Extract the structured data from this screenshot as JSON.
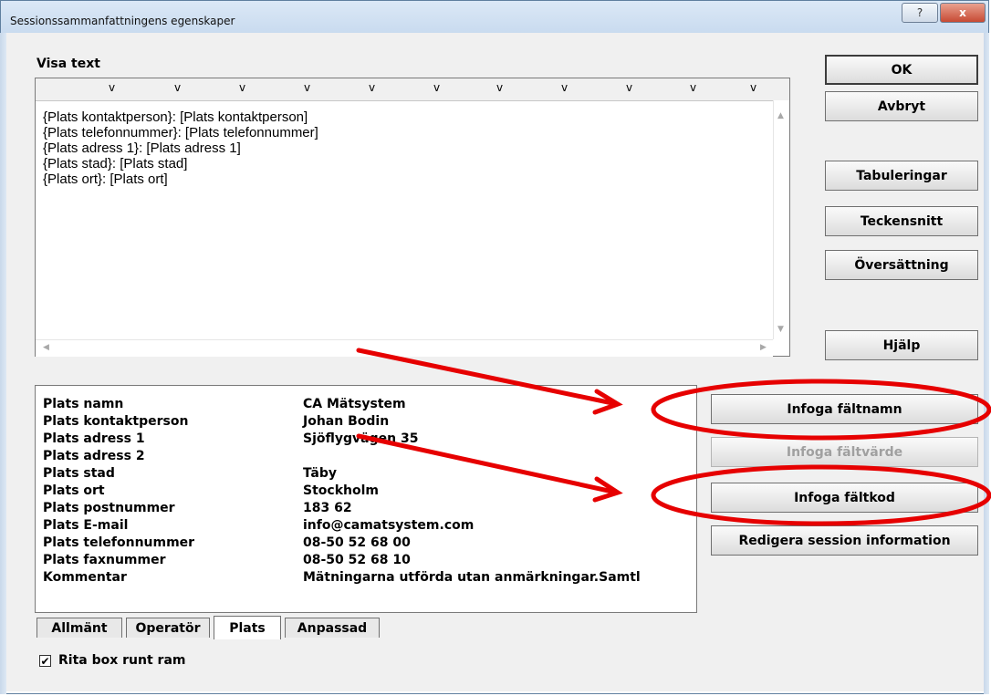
{
  "window": {
    "title": "Sessionssammanfattningens egenskaper",
    "help_glyph": "?",
    "close_glyph": "x"
  },
  "display_text": {
    "label": "Visa text",
    "ruler_marks": [
      "v",
      "v",
      "v",
      "v",
      "v",
      "v",
      "v",
      "v",
      "v",
      "v",
      "v"
    ],
    "lines": [
      "{Plats kontaktperson}: [Plats kontaktperson]",
      "{Plats telefonnummer}: [Plats telefonnummer]",
      "{Plats adress 1}: [Plats adress 1]",
      "{Plats stad}: [Plats stad]",
      "{Plats ort}: [Plats ort]"
    ],
    "scroll_up": "▲",
    "scroll_down": "▼",
    "scroll_left": "◀",
    "scroll_right": "▶"
  },
  "buttons": {
    "ok": "OK",
    "cancel": "Avbryt",
    "tabs_setup": "Tabuleringar",
    "font": "Teckensnitt",
    "translation": "Översättning",
    "help": "Hjälp",
    "insert_field_name": "Infoga fältnamn",
    "insert_field_value": "Infoga fältvärde",
    "insert_field_code": "Infoga fältkod",
    "edit_session_info": "Redigera session information"
  },
  "fields": [
    {
      "name": "Plats namn",
      "value": "CA Mätsystem"
    },
    {
      "name": "Plats kontaktperson",
      "value": "Johan Bodin"
    },
    {
      "name": "Plats adress 1",
      "value": "Sjöflygvägen 35"
    },
    {
      "name": "Plats adress 2",
      "value": ""
    },
    {
      "name": "Plats stad",
      "value": "Täby"
    },
    {
      "name": "Plats ort",
      "value": "Stockholm"
    },
    {
      "name": "Plats postnummer",
      "value": "183 62"
    },
    {
      "name": "Plats E-mail",
      "value": "info@camatsystem.com"
    },
    {
      "name": "Plats telefonnummer",
      "value": "08-50 52 68 00"
    },
    {
      "name": "Plats faxnummer",
      "value": "08-50 52 68 10"
    },
    {
      "name": "Kommentar",
      "value": "Mätningarna utförda utan anmärkningar.Samtl"
    }
  ],
  "tabs": [
    {
      "label": "Allmänt",
      "active": false
    },
    {
      "label": "Operatör",
      "active": false
    },
    {
      "label": "Plats",
      "active": true
    },
    {
      "label": "Anpassad",
      "active": false
    }
  ],
  "draw_box": {
    "label": "Rita box runt ram",
    "checked": true,
    "mark": "✔"
  },
  "colors": {
    "annotation": "#e60000"
  }
}
